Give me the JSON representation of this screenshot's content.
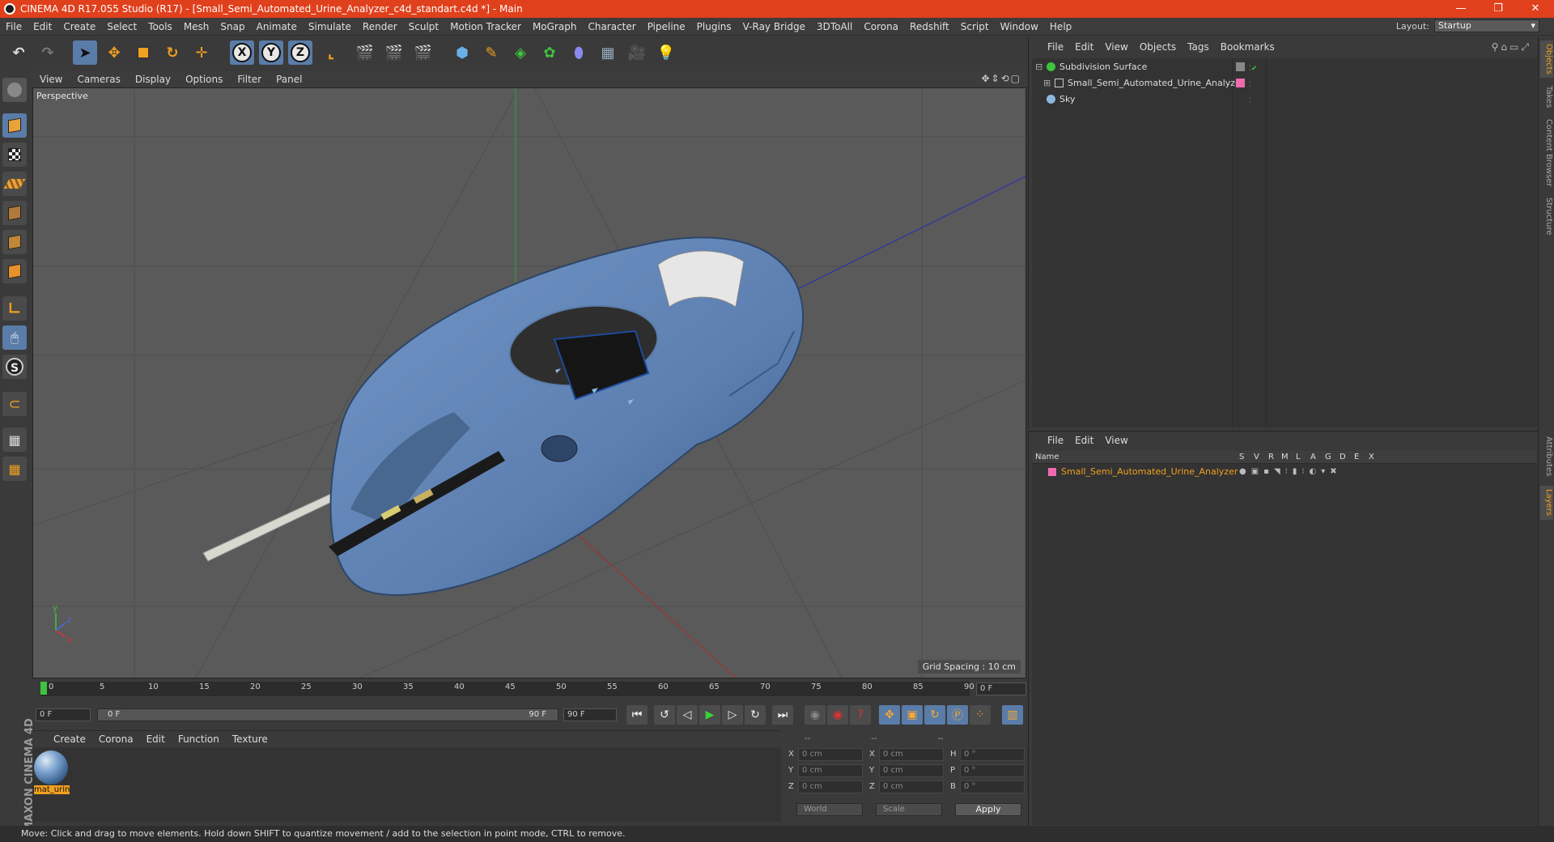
{
  "window": {
    "title": "CINEMA 4D R17.055 Studio (R17) - [Small_Semi_Automated_Urine_Analyzer_c4d_standart.c4d *] - Main",
    "controls": [
      "—",
      "❐",
      "✕"
    ]
  },
  "menubar": {
    "items": [
      "File",
      "Edit",
      "Create",
      "Select",
      "Tools",
      "Mesh",
      "Snap",
      "Animate",
      "Simulate",
      "Render",
      "Sculpt",
      "Motion Tracker",
      "MoGraph",
      "Character",
      "Pipeline",
      "Plugins",
      "V-Ray Bridge",
      "3DToAll",
      "Corona",
      "Redshift",
      "Script",
      "Window",
      "Help"
    ],
    "layout_label": "Layout:",
    "layout_value": "Startup"
  },
  "toolbar": {
    "axis_labels": [
      "X",
      "Y",
      "Z"
    ]
  },
  "viewport": {
    "menu": [
      "View",
      "Cameras",
      "Display",
      "Options",
      "Filter",
      "Panel"
    ],
    "camera_label": "Perspective",
    "grid_spacing": "Grid Spacing : 10 cm",
    "axis_gizmo": {
      "y": "y",
      "z": "z",
      "x": "x"
    }
  },
  "timeline": {
    "ticks": [
      "0",
      "5",
      "10",
      "15",
      "20",
      "25",
      "30",
      "35",
      "40",
      "45",
      "50",
      "55",
      "60",
      "65",
      "70",
      "75",
      "80",
      "85",
      "90"
    ],
    "current_frame": "0 F"
  },
  "transport": {
    "start_field": "0 F",
    "slider_start": "0 F",
    "slider_end": "90 F",
    "end_field": "90 F"
  },
  "material_manager": {
    "menu": [
      "Create",
      "Corona",
      "Edit",
      "Function",
      "Texture"
    ],
    "materials": [
      {
        "name": "mat_urin"
      }
    ]
  },
  "coordinates": {
    "headers": [
      "--",
      "--",
      "--"
    ],
    "rows": [
      {
        "l1": "X",
        "v1": "0 cm",
        "l2": "X",
        "v2": "0 cm",
        "l3": "H",
        "v3": "0 °"
      },
      {
        "l1": "Y",
        "v1": "0 cm",
        "l2": "Y",
        "v2": "0 cm",
        "l3": "P",
        "v3": "0 °"
      },
      {
        "l1": "Z",
        "v1": "0 cm",
        "l2": "Z",
        "v2": "0 cm",
        "l3": "B",
        "v3": "0 °"
      }
    ],
    "mode_dropdown": "World",
    "size_dropdown": "Scale",
    "apply_label": "Apply"
  },
  "object_manager": {
    "menu": [
      "File",
      "Edit",
      "View",
      "Objects",
      "Tags",
      "Bookmarks"
    ],
    "objects": [
      {
        "name": "Subdivision Surface",
        "icon_color": "#3ec43e"
      },
      {
        "name": "Small_Semi_Automated_Urine_Analyzer",
        "icon_color": "#cfcfcf"
      },
      {
        "name": "Sky",
        "icon_color": "#8fb8e0"
      }
    ]
  },
  "layer_manager": {
    "menu": [
      "File",
      "Edit",
      "View"
    ],
    "columns": [
      "Name",
      "S",
      "V",
      "R",
      "M",
      "L",
      "A",
      "G",
      "D",
      "E",
      "X"
    ],
    "layers": [
      {
        "name": "Small_Semi_Automated_Urine_Analyzer",
        "color": "#f06ab0"
      }
    ]
  },
  "side_tabs": [
    "Objects",
    "Takes",
    "Content Browser",
    "Structure",
    "Attributes",
    "Layers"
  ],
  "status": "Move: Click and drag to move elements. Hold down SHIFT to quantize movement / add to the selection in point mode, CTRL to remove.",
  "brand": "MAXON CINEMA 4D",
  "colors": {
    "title_bar": "#e0401c",
    "selected_tool": "#5a7ca8",
    "accent": "#f0a020",
    "model_body": "#5c7fb0"
  }
}
